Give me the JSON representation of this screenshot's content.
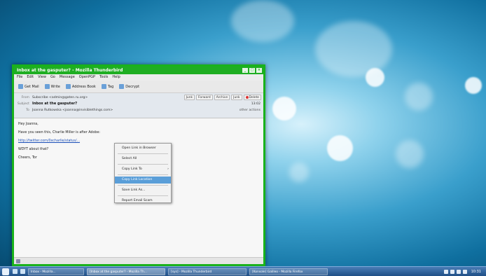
{
  "window": {
    "title": "Inbox at the gasputer? - Mozilla Thunderbird",
    "menu": [
      "File",
      "Edit",
      "View",
      "Go",
      "Message",
      "OpenPGP",
      "Tools",
      "Help"
    ],
    "toolbar": [
      "Get Mail",
      "Write",
      "Address Book",
      "Tag",
      "Decrypt"
    ],
    "header": {
      "from_label": "From",
      "from": "Subscribe <admin@gaten.ru.org>",
      "subject_label": "Subject",
      "subject": "Inbox at the gasputer?",
      "to_label": "To",
      "to": "Joanna Rutkowska <joanna@invisiblethings.com>",
      "buttons": [
        "Junk",
        "Forward",
        "Archive",
        "Junk",
        "Delete"
      ],
      "time": "13:02",
      "other_actions": "other actions"
    },
    "body": {
      "greeting": "Hey Joanna,",
      "line1": "Have you seen this, Charlie Miller is after Adobe:",
      "link": "http://twitter.com/0xcharlie/status/...",
      "line2": "WDYT about that?",
      "signoff": "Cheers, Tor"
    }
  },
  "context_menu": {
    "items": [
      "Open Link in Browser",
      "Select All",
      "Copy Link To",
      "Copy Link Location",
      "Save Link As...",
      "Report Email Scam"
    ]
  },
  "taskbar": {
    "tasks": [
      "Inbox - Mozilla...",
      "[Inbox at the gasputer? - Mozilla Th...",
      "[sys] - Mozilla Thunderbird",
      "[Konsole] Galileo - Mozilla Firefox"
    ],
    "clock": "10:31"
  }
}
